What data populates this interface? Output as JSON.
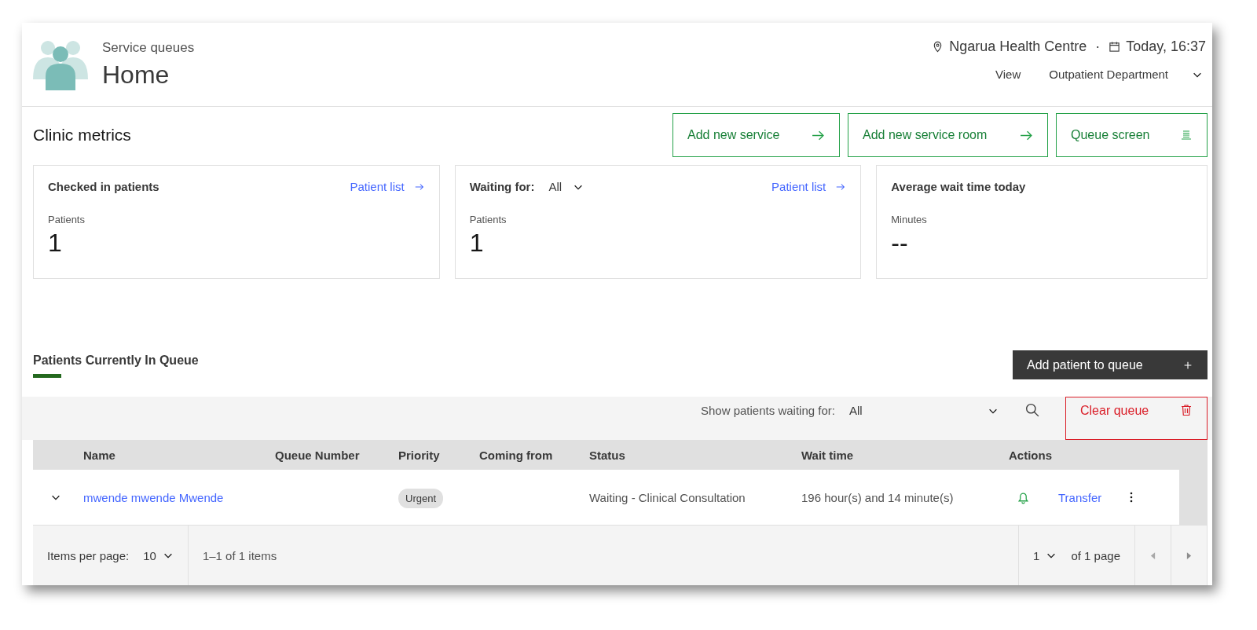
{
  "header": {
    "subtitle": "Service queues",
    "title": "Home",
    "location": "Ngarua Health Centre",
    "separator": "·",
    "date": "Today, 16:37",
    "view_label": "View",
    "view_value": "Outpatient Department"
  },
  "metrics": {
    "title": "Clinic metrics",
    "buttons": [
      {
        "label": "Add new service",
        "kind": "arrow"
      },
      {
        "label": "Add new service room",
        "kind": "arrow"
      },
      {
        "label": "Queue screen",
        "kind": "screen"
      }
    ],
    "cards": [
      {
        "kind": "plain",
        "title": "Checked in patients",
        "link": "Patient list",
        "label": "Patients",
        "value": "1"
      },
      {
        "kind": "filter",
        "title": "Waiting for:",
        "filter_value": "All",
        "link": "Patient list",
        "label": "Patients",
        "value": "1"
      },
      {
        "kind": "plain",
        "title": "Average wait time today",
        "label": "Minutes",
        "value": "--"
      }
    ]
  },
  "queue": {
    "title": "Patients Currently In Queue",
    "add_button": "Add patient to queue",
    "filter_label": "Show patients waiting for:",
    "filter_value": "All",
    "clear_button": "Clear queue",
    "columns": [
      "Name",
      "Queue Number",
      "Priority",
      "Coming from",
      "Status",
      "Wait time",
      "Actions"
    ],
    "rows": [
      {
        "name": "mwende mwende Mwende",
        "priority": "Urgent",
        "status": "Waiting - Clinical Consultation",
        "wait_time": "196 hour(s) and 14 minute(s)",
        "action_link": "Transfer"
      }
    ],
    "pagination": {
      "items_label": "Items per page:",
      "items_per_page": "10",
      "range": "1–1 of 1 items",
      "page": "1",
      "page_total": "of 1 page"
    }
  }
}
